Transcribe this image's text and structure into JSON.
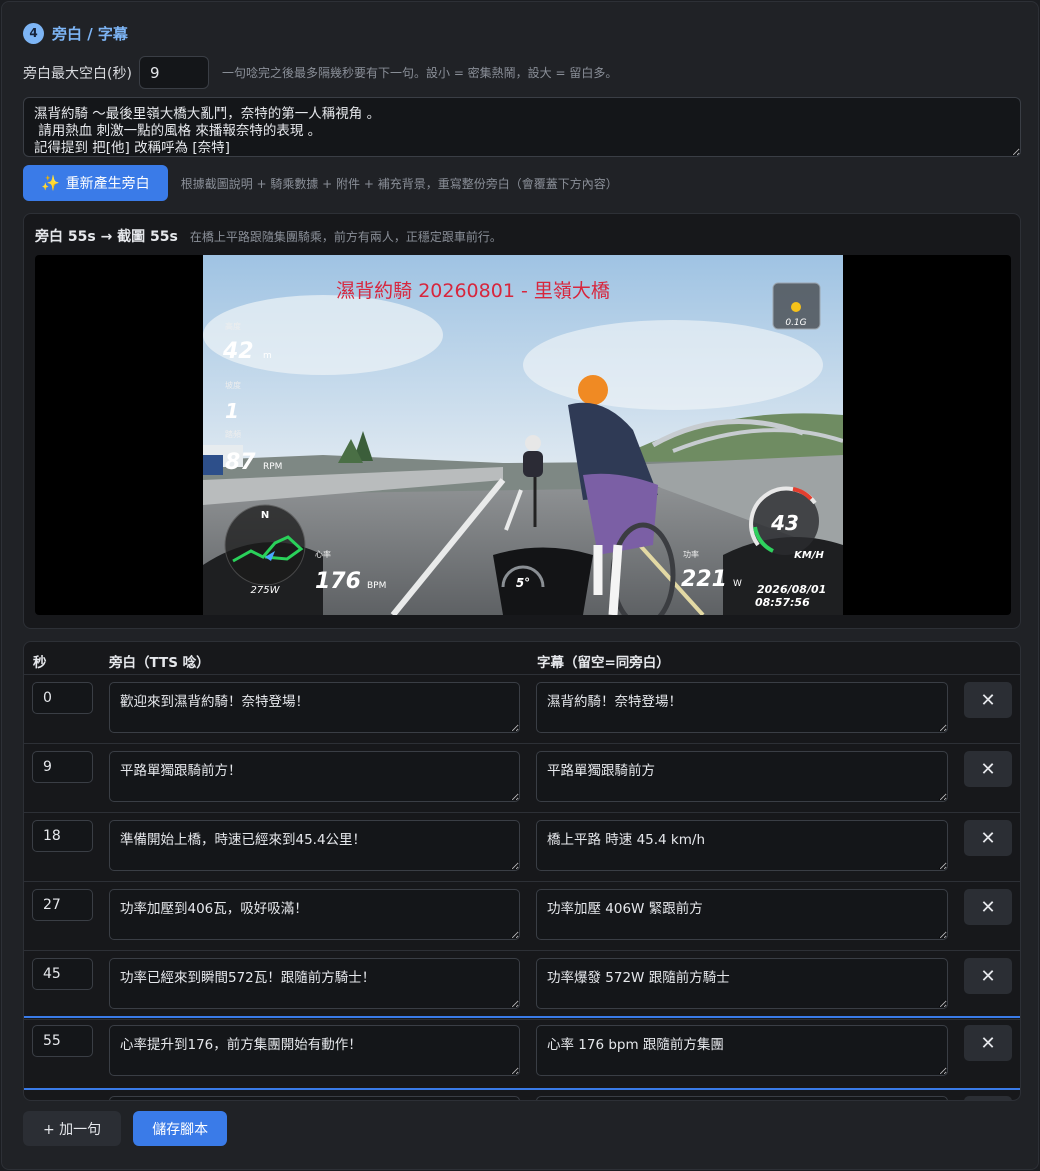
{
  "section": {
    "step": "4",
    "title": "旁白 / 字幕"
  },
  "gap": {
    "label": "旁白最大空白(秒)",
    "value": "9",
    "hint": "一句唸完之後最多隔幾秒要有下一句。設小 = 密集熱鬧，設大 = 留白多。"
  },
  "prompt": {
    "text": "濕背約騎 ～最後里嶺大橋大亂鬥，奈特的第一人稱視角 。\n 請用熱血 刺激一點的風格 來播報奈特的表現 。\n記得提到 把[他] 改稱呼為 [奈特]"
  },
  "regenerate": {
    "icon": "sparkle-icon",
    "label": "重新產生旁白",
    "hint": "根據截圖說明 + 騎乘數據 + 附件 + 補充背景，重寫整份旁白（會覆蓋下方內容）"
  },
  "preview": {
    "title": "旁白 55s → 截圖 55s",
    "description": "在橋上平路跟隨集團騎乘，前方有兩人，正穩定跟車前行。",
    "overlay": {
      "video_title": "濕背約騎 20260801 - 里嶺大橋",
      "gforce": "0.1G",
      "m1_label": "高度",
      "m1_value": "42",
      "m1_unit": "m",
      "m2_label": "坡度",
      "m2_value": "1",
      "m3_label": "踏頻",
      "m3_value": "87",
      "m3_unit": "RPM",
      "compass": "N",
      "power_small": "275W",
      "hr_label": "心率",
      "hr_value": "176",
      "hr_unit": "BPM",
      "temp": "5°",
      "power_label": "功率",
      "power_value": "221",
      "power_unit": "W",
      "speed_value": "43",
      "speed_unit": "KM/H",
      "date": "2026/08/01",
      "time": "08:57:56"
    }
  },
  "table": {
    "headers": {
      "sec": "秒",
      "narration": "旁白（TTS 唸）",
      "subtitle": "字幕（留空=同旁白）"
    },
    "rows": [
      {
        "sec": "0",
        "narration": "歡迎來到濕背約騎！奈特登場！",
        "subtitle": "濕背約騎！奈特登場！"
      },
      {
        "sec": "9",
        "narration": "平路單獨跟騎前方！",
        "subtitle": "平路單獨跟騎前方"
      },
      {
        "sec": "18",
        "narration": "準備開始上橋，時速已經來到45.4公里！",
        "subtitle": "橋上平路 時速 45.4 km/h"
      },
      {
        "sec": "27",
        "narration": "功率加壓到406瓦，吸好吸滿！",
        "subtitle": "功率加壓 406W 緊跟前方"
      },
      {
        "sec": "45",
        "narration": "功率已經來到瞬間572瓦！跟隨前方騎士！",
        "subtitle": "功率爆發 572W 跟隨前方騎士"
      },
      {
        "sec": "55",
        "narration": "心率提升到176，前方集團開始有動作！",
        "subtitle": "心率 176 bpm 跟隨前方集團",
        "active": true
      }
    ],
    "delete_icon": "close-icon",
    "delete_glyph": "✕"
  },
  "footer": {
    "add_label": "+ 加一句",
    "save_label": "儲存腳本"
  },
  "colors": {
    "accent": "#3a7be8",
    "section_title": "#7db5f5",
    "overlay_red": "#d7263d"
  }
}
